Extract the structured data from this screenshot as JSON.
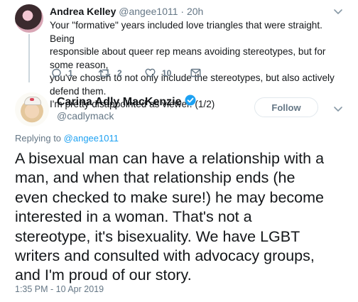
{
  "reply_tweet": {
    "author_name": "Andrea Kelley",
    "handle": "@angee1011",
    "separator": " · ",
    "time": "20h",
    "lines": [
      "Your \"formative\" years included love triangles that were straight. Being",
      "responsible about queer rep means avoiding stereotypes, but for some reason,",
      "you've chosen to not only include the stereotypes, but also actively defend them.",
      "I'm pretty disappointed as viewer. (1/2)"
    ],
    "reply_count": "1",
    "retweet_count": "2",
    "like_count": "10",
    "icons": [
      "reply-icon",
      "retweet-icon",
      "like-icon",
      "direct-message-icon",
      "chevron-down-icon"
    ]
  },
  "main_tweet": {
    "author_name": "Carina Adly MacKenzie",
    "handle": "@cadlymack",
    "follow_label": "Follow",
    "replying_prefix": "Replying to ",
    "replying_to": "@angee1011",
    "lines": [
      "A bisexual man can have a relationship with a",
      "man, and when that relationship ends (he",
      "even checked to make sure!) he may become",
      "interested in a woman. That's not a",
      "stereotype, it's bisexuality. We have LGBT",
      "writers and consulted with advocacy groups,",
      "and I'm proud of our story."
    ],
    "timestamp": "1:35 PM - 10 Apr 2019",
    "icons": [
      "verified-badge-icon",
      "chevron-down-icon"
    ]
  },
  "colors": {
    "text": "#14171a",
    "muted": "#657786",
    "accent": "#1da1f2",
    "border": "#e1e8ed",
    "thread_line": "#ccd6dd"
  }
}
